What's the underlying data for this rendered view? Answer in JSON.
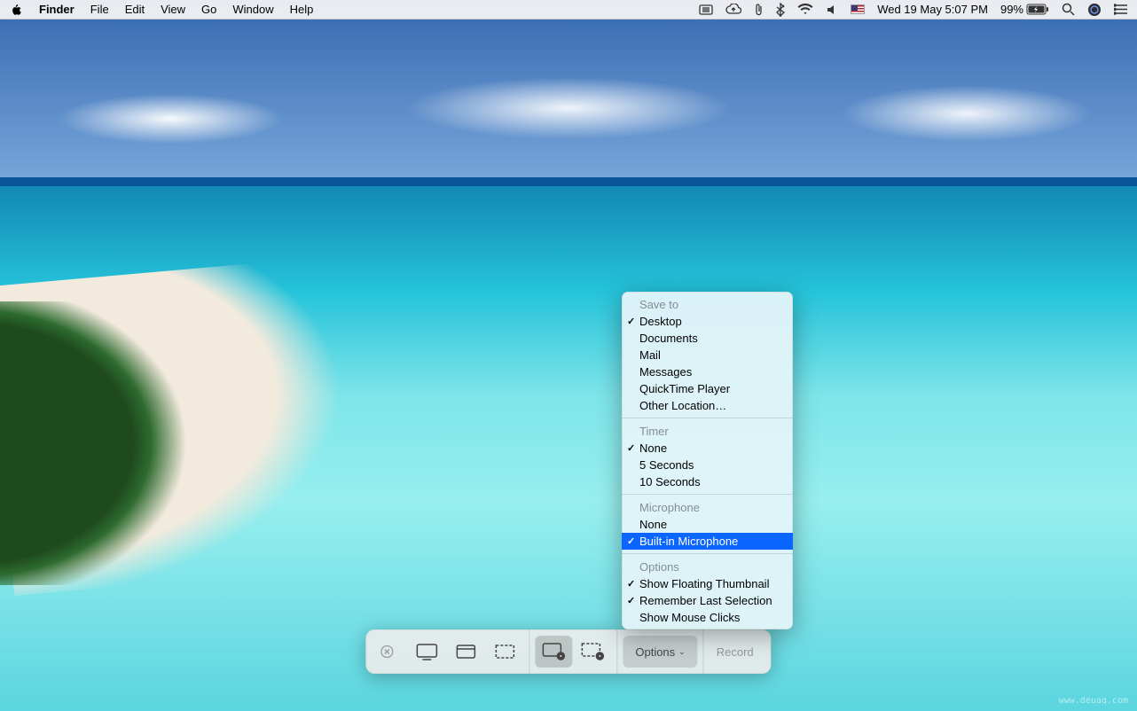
{
  "menubar": {
    "app": "Finder",
    "items": [
      "File",
      "Edit",
      "View",
      "Go",
      "Window",
      "Help"
    ],
    "datetime": "Wed 19 May  5:07 PM",
    "battery": "99%"
  },
  "toolbar": {
    "options_label": "Options",
    "record_label": "Record"
  },
  "popup": {
    "sections": [
      {
        "header": "Save to",
        "items": [
          {
            "label": "Desktop",
            "checked": true
          },
          {
            "label": "Documents",
            "checked": false
          },
          {
            "label": "Mail",
            "checked": false
          },
          {
            "label": "Messages",
            "checked": false
          },
          {
            "label": "QuickTime Player",
            "checked": false
          },
          {
            "label": "Other Location…",
            "checked": false
          }
        ]
      },
      {
        "header": "Timer",
        "items": [
          {
            "label": "None",
            "checked": true
          },
          {
            "label": "5 Seconds",
            "checked": false
          },
          {
            "label": "10 Seconds",
            "checked": false
          }
        ]
      },
      {
        "header": "Microphone",
        "items": [
          {
            "label": "None",
            "checked": false
          },
          {
            "label": "Built-in Microphone",
            "checked": true,
            "selected": true
          }
        ]
      },
      {
        "header": "Options",
        "items": [
          {
            "label": "Show Floating Thumbnail",
            "checked": true
          },
          {
            "label": "Remember Last Selection",
            "checked": true
          },
          {
            "label": "Show Mouse Clicks",
            "checked": false
          }
        ]
      }
    ]
  },
  "watermark": "www.deuaq.com"
}
